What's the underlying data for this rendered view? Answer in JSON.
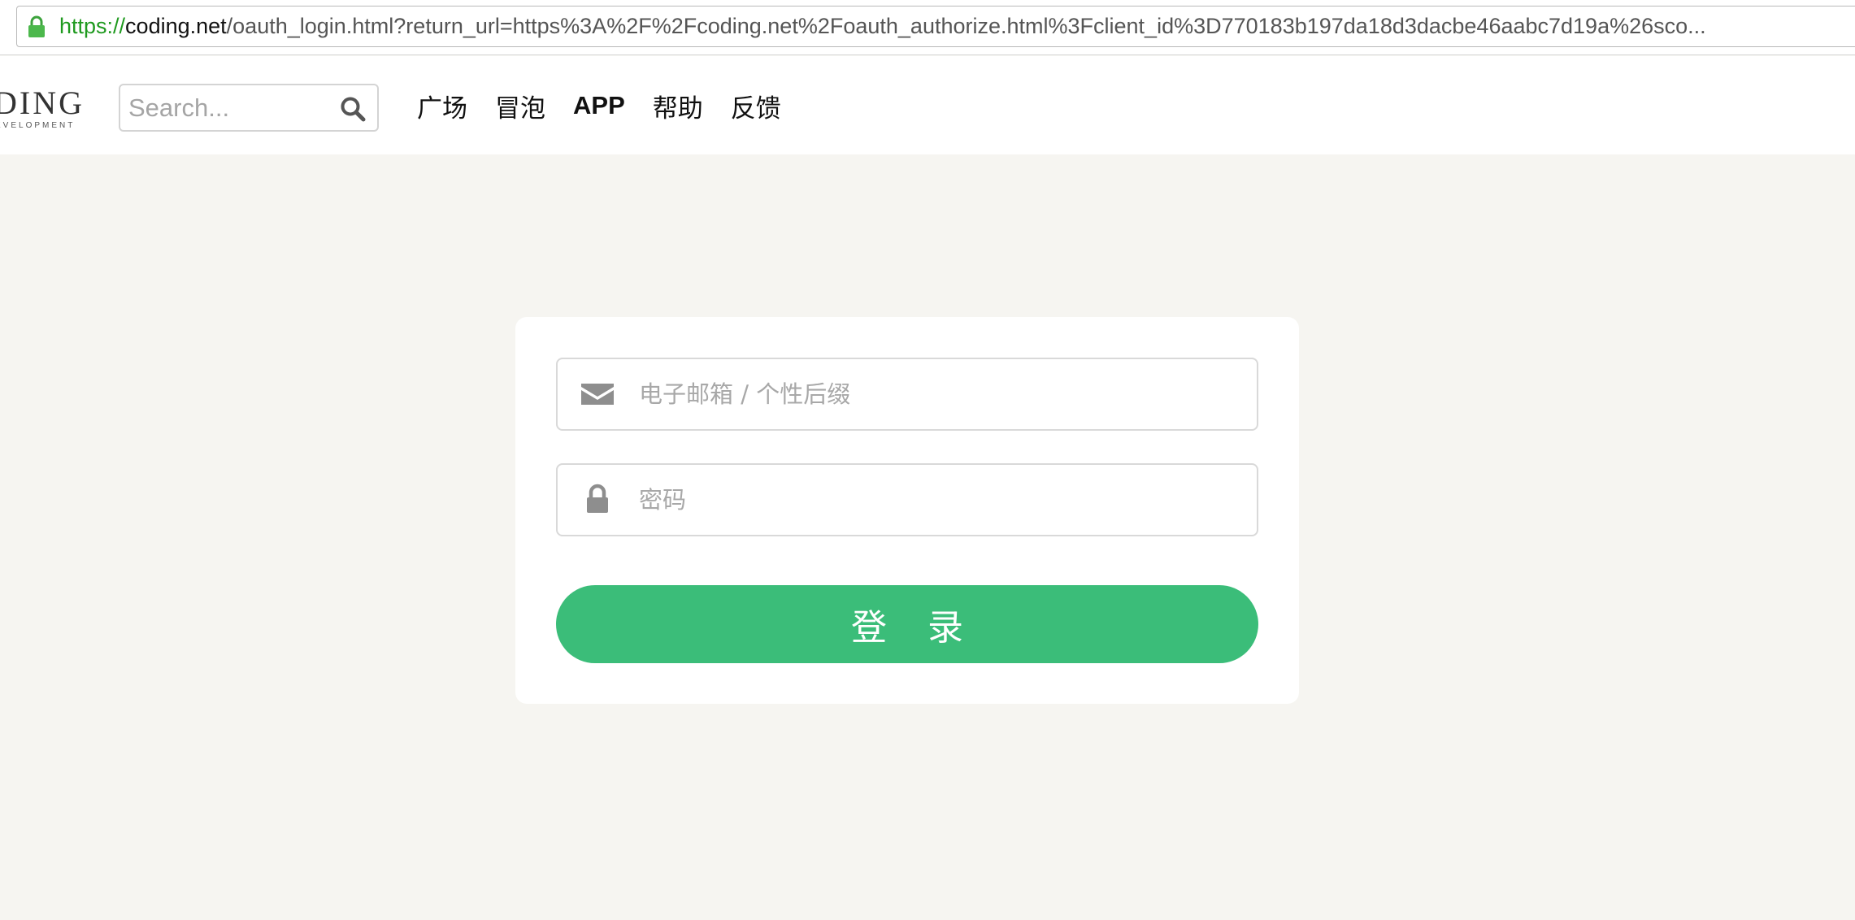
{
  "browser": {
    "url_scheme": "https://",
    "url_domain": "coding.net",
    "url_path": "/oauth_login.html?return_url=https%3A%2F%2Fcoding.net%2Foauth_authorize.html%3Fclient_id%3D770183b197da18d3dacbe46aabc7d19a%26sco...",
    "lock_icon": "lock-icon"
  },
  "header": {
    "logo_text": "DING",
    "logo_subtext": "EVELOPMENT",
    "search_placeholder": "Search...",
    "nav": [
      {
        "label": "广场"
      },
      {
        "label": "冒泡"
      },
      {
        "label": "APP"
      },
      {
        "label": "帮助"
      },
      {
        "label": "反馈"
      }
    ]
  },
  "login": {
    "email_placeholder": "电子邮箱 / 个性后缀",
    "email_value": "",
    "password_placeholder": "密码",
    "password_value": "",
    "submit_label": "登 录"
  },
  "colors": {
    "page_background": "#f6f5f1",
    "accent_green": "#3bbd79",
    "url_scheme_green": "#1f9a1f"
  }
}
